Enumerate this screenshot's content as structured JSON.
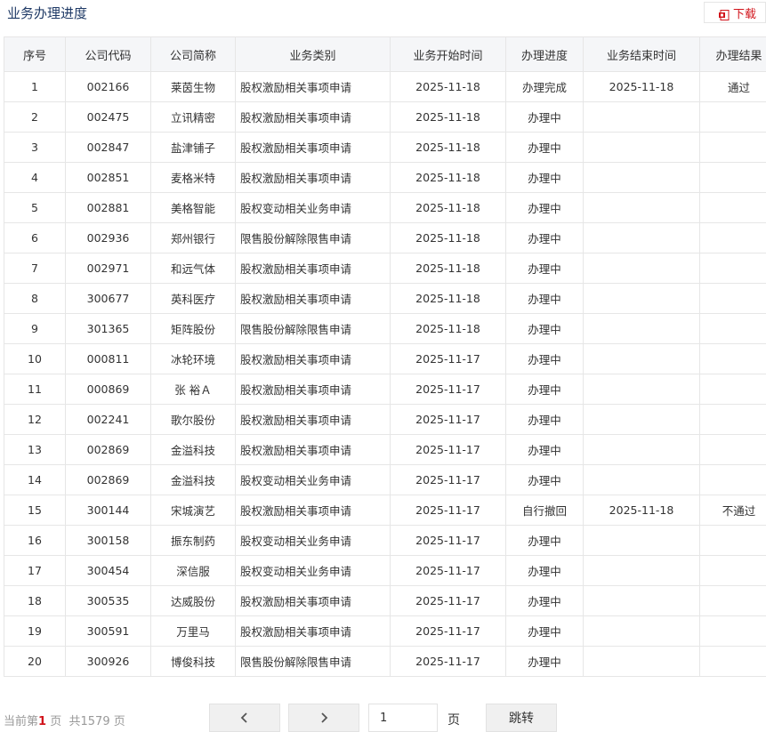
{
  "header": {
    "title": "业务办理进度",
    "download_label": "下载",
    "download_icon": "pdf-download-icon"
  },
  "table": {
    "columns": [
      "序号",
      "公司代码",
      "公司简称",
      "业务类别",
      "业务开始时间",
      "办理进度",
      "业务结束时间",
      "办理结果"
    ],
    "rows": [
      [
        "1",
        "002166",
        "莱茵生物",
        "股权激励相关事项申请",
        "2025-11-18",
        "办理完成",
        "2025-11-18",
        "通过"
      ],
      [
        "2",
        "002475",
        "立讯精密",
        "股权激励相关事项申请",
        "2025-11-18",
        "办理中",
        "",
        ""
      ],
      [
        "3",
        "002847",
        "盐津铺子",
        "股权激励相关事项申请",
        "2025-11-18",
        "办理中",
        "",
        ""
      ],
      [
        "4",
        "002851",
        "麦格米特",
        "股权激励相关事项申请",
        "2025-11-18",
        "办理中",
        "",
        ""
      ],
      [
        "5",
        "002881",
        "美格智能",
        "股权变动相关业务申请",
        "2025-11-18",
        "办理中",
        "",
        ""
      ],
      [
        "6",
        "002936",
        "郑州银行",
        "限售股份解除限售申请",
        "2025-11-18",
        "办理中",
        "",
        ""
      ],
      [
        "7",
        "002971",
        "和远气体",
        "股权激励相关事项申请",
        "2025-11-18",
        "办理中",
        "",
        ""
      ],
      [
        "8",
        "300677",
        "英科医疗",
        "股权激励相关事项申请",
        "2025-11-18",
        "办理中",
        "",
        ""
      ],
      [
        "9",
        "301365",
        "矩阵股份",
        "限售股份解除限售申请",
        "2025-11-18",
        "办理中",
        "",
        ""
      ],
      [
        "10",
        "000811",
        "冰轮环境",
        "股权激励相关事项申请",
        "2025-11-17",
        "办理中",
        "",
        ""
      ],
      [
        "11",
        "000869",
        "张 裕Ａ",
        "股权激励相关事项申请",
        "2025-11-17",
        "办理中",
        "",
        ""
      ],
      [
        "12",
        "002241",
        "歌尔股份",
        "股权激励相关事项申请",
        "2025-11-17",
        "办理中",
        "",
        ""
      ],
      [
        "13",
        "002869",
        "金溢科技",
        "股权激励相关事项申请",
        "2025-11-17",
        "办理中",
        "",
        ""
      ],
      [
        "14",
        "002869",
        "金溢科技",
        "股权变动相关业务申请",
        "2025-11-17",
        "办理中",
        "",
        ""
      ],
      [
        "15",
        "300144",
        "宋城演艺",
        "股权激励相关事项申请",
        "2025-11-17",
        "自行撤回",
        "2025-11-18",
        "不通过"
      ],
      [
        "16",
        "300158",
        "振东制药",
        "股权变动相关业务申请",
        "2025-11-17",
        "办理中",
        "",
        ""
      ],
      [
        "17",
        "300454",
        "深信服",
        "股权变动相关业务申请",
        "2025-11-17",
        "办理中",
        "",
        ""
      ],
      [
        "18",
        "300535",
        "达威股份",
        "股权激励相关事项申请",
        "2025-11-17",
        "办理中",
        "",
        ""
      ],
      [
        "19",
        "300591",
        "万里马",
        "股权激励相关事项申请",
        "2025-11-17",
        "办理中",
        "",
        ""
      ],
      [
        "20",
        "300926",
        "博俊科技",
        "限售股份解除限售申请",
        "2025-11-17",
        "办理中",
        "",
        ""
      ]
    ]
  },
  "pagination": {
    "prefix": "当前第",
    "current_page": "1",
    "page_suffix": "页",
    "total_prefix": "共",
    "total_pages": "1579",
    "total_suffix": "页",
    "prev_icon": "chevron-left-icon",
    "next_icon": "chevron-right-icon",
    "input_value": "1",
    "input_unit": "页",
    "jump_label": "跳转"
  },
  "colors": {
    "accent_red": "#d1141b",
    "title_blue": "#1f3a66",
    "header_bg": "#f5f6f8",
    "border": "#e6e6e6"
  }
}
